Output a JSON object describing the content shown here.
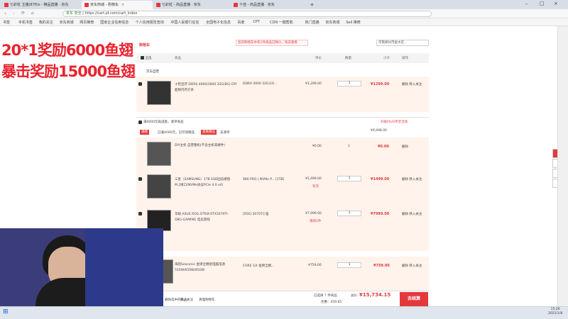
{
  "browser": {
    "tabs": [
      {
        "label": "七彩虹 主播(878)s - 精品直播 · 京东",
        "active": false
      },
      {
        "label": "京东商城 - 购物车",
        "active": true
      },
      {
        "label": "七彩虹 - 商品直播 · 京东",
        "active": false
      },
      {
        "label": "十佳 - 商品直播 · 京东",
        "active": false
      }
    ],
    "url": "https://cart.jd.com/cart_index",
    "secure_label": "京东 安全",
    "bookmarks": [
      "书签",
      "手机书签",
      "我的关注",
      "京东商城",
      "网页推荐",
      "国家企业信用信息",
      "个人信用报告查询",
      "中国人民银行征信",
      "全国电子化信息",
      "百度",
      "CPT",
      "CDN 一键帮助",
      "热门直播",
      "京东商城",
      "Sell 推荐"
    ]
  },
  "overlay": {
    "line1": "20*1奖励6000鱼翅",
    "line2": "暴击奖励15000鱼翅"
  },
  "cart": {
    "section_title": "购物车",
    "notice": "您的购物车中有1件商品已降价，快去看看",
    "address": "河南郑州市金水区...",
    "headers": [
      "全选",
      "商品",
      "",
      "单价",
      "数量",
      "小计",
      "操作"
    ],
    "shop_name": "京东自营",
    "items": [
      {
        "title": "十铨显存 DDR4 4000/3600 32G(8G) DIY超频内存灯条",
        "spec": "DDR4 4000 32G(16...",
        "price": "¥1,299.00",
        "qty": "1",
        "subtotal": "¥1299.00",
        "actions": "删除 移入关注"
      },
      {
        "title": "DIY主机 自营整机(不含主机等硬件)",
        "spec": "",
        "price": "¥0.00",
        "qty": "1",
        "subtotal": "¥0.00",
        "actions": "删除"
      },
      {
        "title": "三星（SAMSUNG）1TB SSD固态硬盘 M.2接口(NVMe协议PCIe 4.0 x4)",
        "spec": "980 PRO | NVMe P... [1TB]",
        "price": "¥1,499.00",
        "qty": "1",
        "subtotal": "¥1499.00",
        "actions": "删除 移入关注"
      },
      {
        "title": "华硕 ASUS ROG-STRIX-RTX3070TI-O8G-GAMING 电竞游戏",
        "spec": "[ROG-3070Ti] 猛",
        "price": "¥7,999.00",
        "qty": "1",
        "subtotal": "¥7999.00",
        "actions": "删除 移入关注"
      },
      {
        "title": "海韵Seasonic 金牌全模组电脑电源 550W/650W/850W",
        "spec": "CORE GX 金牌全模...",
        "price": "¥759.00",
        "qty": "1",
        "subtotal": "¥759.00",
        "actions": "删除 移入关注"
      }
    ],
    "promo_bar": "满4000元再减金，凑单商品",
    "promo_total": "¥9,498.00",
    "promo_tags": [
      "满赠",
      "已满4000元，已可领赠品",
      "查看赠品",
      "去凑单"
    ],
    "promo_right": "升级PLUS专享活动",
    "stock_tags": [
      "有货",
      "有货",
      "限购1件"
    ],
    "footer": {
      "selected": "已选择 7 件商品",
      "total_label": "总价：",
      "total": "¥15,734.15",
      "discount": "优惠：459.85",
      "links": [
        "删除选中的商品",
        "移入关注",
        "清理购物车"
      ],
      "checkout": "去结算"
    }
  },
  "taskbar": {
    "time": "15:26",
    "date": "2021/1/8"
  },
  "colors": {
    "accent": "#e4393c",
    "overlay": "#e8242f",
    "band": "#fff3ec"
  }
}
